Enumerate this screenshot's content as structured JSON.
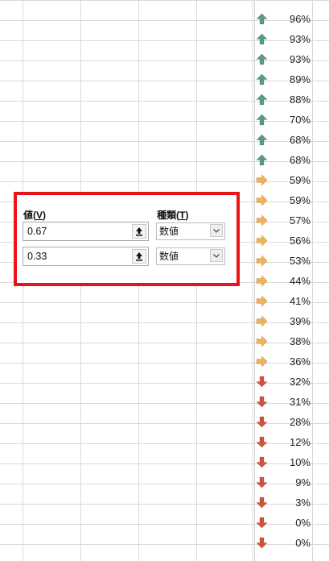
{
  "grid": {
    "values": [
      "96%",
      "93%",
      "93%",
      "89%",
      "88%",
      "70%",
      "68%",
      "68%",
      "59%",
      "59%",
      "57%",
      "56%",
      "53%",
      "44%",
      "41%",
      "39%",
      "38%",
      "36%",
      "32%",
      "31%",
      "28%",
      "12%",
      "10%",
      "9%",
      "3%",
      "0%",
      "0%"
    ],
    "icons": [
      "up-arrow-icon",
      "up-arrow-icon",
      "up-arrow-icon",
      "up-arrow-icon",
      "up-arrow-icon",
      "up-arrow-icon",
      "up-arrow-icon",
      "up-arrow-icon",
      "right-arrow-icon",
      "right-arrow-icon",
      "right-arrow-icon",
      "right-arrow-icon",
      "right-arrow-icon",
      "right-arrow-icon",
      "right-arrow-icon",
      "right-arrow-icon",
      "right-arrow-icon",
      "right-arrow-icon",
      "down-arrow-icon",
      "down-arrow-icon",
      "down-arrow-icon",
      "down-arrow-icon",
      "down-arrow-icon",
      "down-arrow-icon",
      "down-arrow-icon",
      "down-arrow-icon",
      "down-arrow-icon"
    ]
  },
  "colors": {
    "up": "#5a9b84",
    "right": "#f2b354",
    "down": "#d5523a",
    "highlight": "#e8141a"
  },
  "rule_panel": {
    "value_label": "値(V)",
    "value_label_main": "値(",
    "value_label_key": "V",
    "value_label_end": ")",
    "type_label_main": "種類(",
    "type_label_key": "T",
    "type_label_end": ")",
    "row1": {
      "value": "0.67",
      "type": "数値"
    },
    "row2": {
      "value": "0.33",
      "type": "数値"
    }
  }
}
